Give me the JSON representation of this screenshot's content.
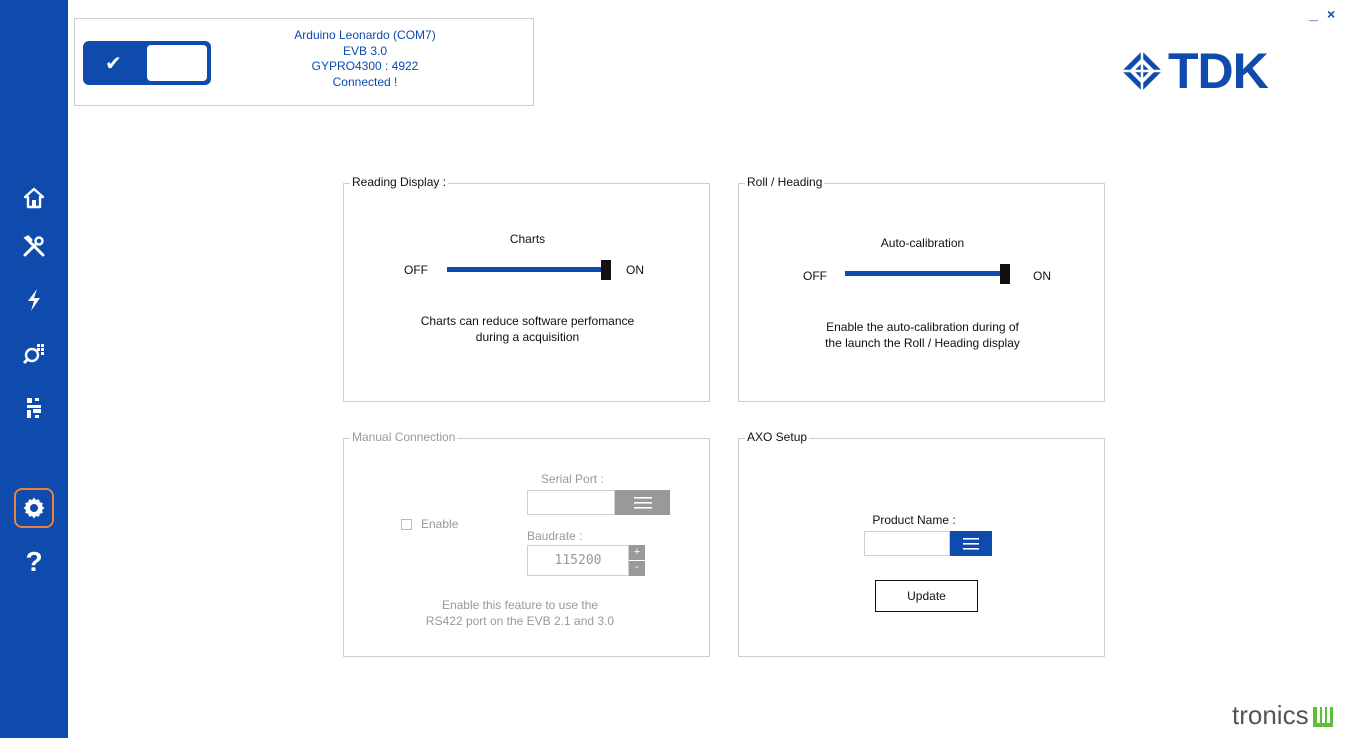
{
  "connection": {
    "board": "Arduino Leonardo (COM7)",
    "evb": "EVB 3.0",
    "sensor": "GYPRO4300 : 4922",
    "status": "Connected !",
    "toggle_checked": true
  },
  "window": {
    "minimize": "_",
    "close": "×"
  },
  "logos": {
    "brand": "TDK",
    "partner": "tronics"
  },
  "sidebar": {
    "items": [
      {
        "icon": "home-icon"
      },
      {
        "icon": "tools-icon"
      },
      {
        "icon": "lightning-icon"
      },
      {
        "icon": "search-analysis-icon"
      },
      {
        "icon": "circuit-icon"
      },
      {
        "icon": "gear-icon",
        "active": true
      },
      {
        "icon": "help-icon"
      }
    ]
  },
  "reading_display": {
    "title": "Reading Display :",
    "label": "Charts",
    "off": "OFF",
    "on": "ON",
    "state": "ON",
    "desc_line1": "Charts can reduce software perfomance",
    "desc_line2": "during a acquisition"
  },
  "roll_heading": {
    "title": "Roll / Heading",
    "label": "Auto-calibration",
    "off": "OFF",
    "on": "ON",
    "state": "ON",
    "desc_line1": "Enable the auto-calibration during of",
    "desc_line2": "the launch the Roll / Heading display"
  },
  "manual_connection": {
    "title": "Manual Connection",
    "enable_label": "Enable",
    "enable_checked": false,
    "serial_port_label": "Serial Port :",
    "serial_port_value": "",
    "baudrate_label": "Baudrate :",
    "baudrate_value": "115200",
    "plus": "+",
    "minus": "-",
    "desc_line1": "Enable this feature to use the",
    "desc_line2": "RS422 port on the EVB 2.1 and 3.0"
  },
  "axo_setup": {
    "title": "AXO Setup",
    "product_name_label": "Product Name :",
    "product_name_value": "",
    "update_label": "Update"
  },
  "colors": {
    "accent": "#0f4aad",
    "active_outline": "#e8823a",
    "disabled": "#999999"
  }
}
